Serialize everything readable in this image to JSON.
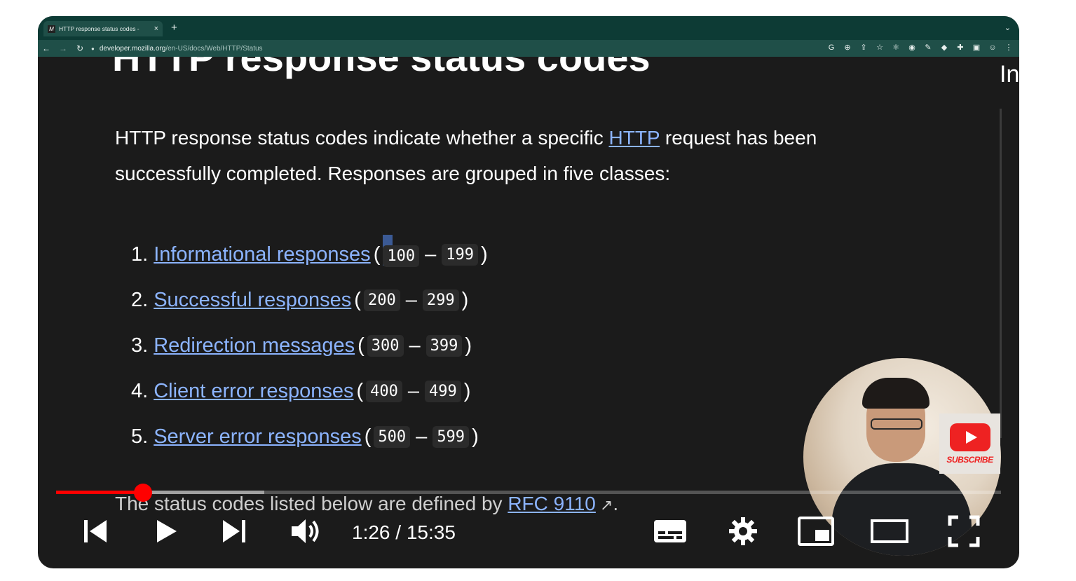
{
  "browser": {
    "tab_title": "HTTP response status codes -",
    "tab_favicon": "M",
    "tab_close": "×",
    "new_tab": "+",
    "tab_menu": "⌄",
    "url_domain": "developer.mozilla.org",
    "url_path": "/en-US/docs/Web/HTTP/Status",
    "colors": {
      "tabbar": "#0d3b35",
      "toolbar": "#1f4f48"
    }
  },
  "page": {
    "heading": "HTTP response status codes",
    "side_heading": "In",
    "intro": {
      "before_link": "HTTP response status codes indicate whether a specific ",
      "link": "HTTP",
      "after_link": " request has been successfully completed. Responses are grouped in five classes:"
    },
    "classes": [
      {
        "num": "1.",
        "label": "Informational responses",
        "open": "(",
        "start": "100",
        "dash": "–",
        "end": "199",
        "close": ")"
      },
      {
        "num": "2.",
        "label": "Successful responses",
        "open": "(",
        "start": "200",
        "dash": "–",
        "end": "299",
        "close": ")"
      },
      {
        "num": "3.",
        "label": "Redirection messages",
        "open": "(",
        "start": "300",
        "dash": "–",
        "end": "399",
        "close": ")"
      },
      {
        "num": "4.",
        "label": "Client error responses",
        "open": "(",
        "start": "400",
        "dash": "–",
        "end": "499",
        "close": ")"
      },
      {
        "num": "5.",
        "label": "Server error responses",
        "open": "(",
        "start": "500",
        "dash": "–",
        "end": "599",
        "close": ")"
      }
    ],
    "footer": {
      "before_link": "The status codes listed below are defined by ",
      "link": "RFC 9110",
      "after_link": "."
    },
    "link_color": "#8cb4ff"
  },
  "overlay": {
    "subscribe_label": "SUBSCRIBE"
  },
  "player": {
    "time": "1:26 / 15:35",
    "progress_played": 0.092,
    "progress_buffered": 0.22,
    "accent_color": "#ff0000",
    "controls": [
      "previous-icon",
      "play-icon",
      "next-icon",
      "volume-icon",
      "captions-icon",
      "settings-icon",
      "miniplayer-icon",
      "theater-icon",
      "fullscreen-icon"
    ]
  }
}
